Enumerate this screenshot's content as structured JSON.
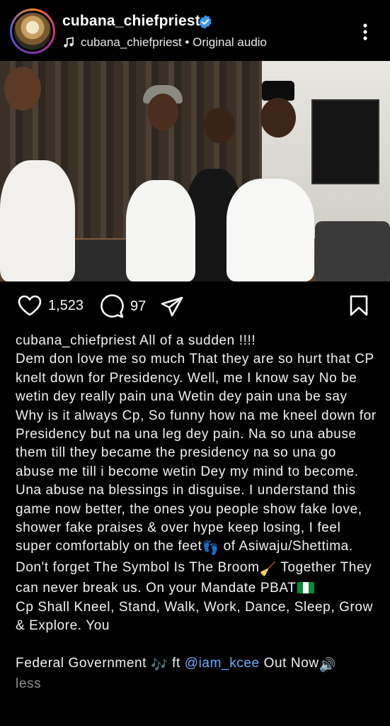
{
  "header": {
    "username": "cubana_chiefpriest",
    "audio_text": "cubana_chiefpriest • Original audio",
    "icons": {
      "avatar": "profile-avatar",
      "verified": "verified-badge-icon",
      "audio": "music-note-icon",
      "more": "more-options-icon"
    }
  },
  "media": {
    "mute_icon": "volume-muted-icon"
  },
  "actions": {
    "likes_count": "1,523",
    "comments_count": "97",
    "icons": {
      "like": "heart-icon",
      "comment": "comment-icon",
      "share": "share-icon",
      "save": "bookmark-icon"
    }
  },
  "caption": {
    "username": "cubana_chiefpriest",
    "line1": " All of a sudden !!!!",
    "line2": "Dem don love me so much That they are so hurt that CP knelt down for Presidency. Well, me I know say No be wetin dey really pain una Wetin dey pain una be say Why is it always Cp, So funny how na me kneel down for Presidency but na una leg dey pain. Na so una abuse them till they became the presidency na so una go abuse me till i become wetin Dey my mind to become. Una abuse na blessings in disguise. I understand this game now better, the ones you people show fake love, shower fake praises & over hype keep losing, I feel super comfortably on the feet",
    "emoji_feet": "👣",
    "line3": " of Asiwaju/Shettima. Don't forget The Symbol Is The Broom",
    "emoji_broom": "🧹",
    "line4": "  Together They can never break us. On your Mandate PBAT",
    "line5": "Cp Shall Kneel, Stand, Walk, Work, Dance, Sleep, Grow & Explore. You",
    "line6_start": "Federal Government ",
    "emoji_music": "🎶",
    "line6_mid": " ft ",
    "mention": "@iam_kcee",
    "line6_end": " Out Now",
    "emoji_speaker": "🔊",
    "less": "less"
  },
  "colors": {
    "background": "#000000",
    "text": "#f2f2f2",
    "mention": "#6ea8ff",
    "muted": "#8e8e8e",
    "verified": "#3897f0"
  }
}
